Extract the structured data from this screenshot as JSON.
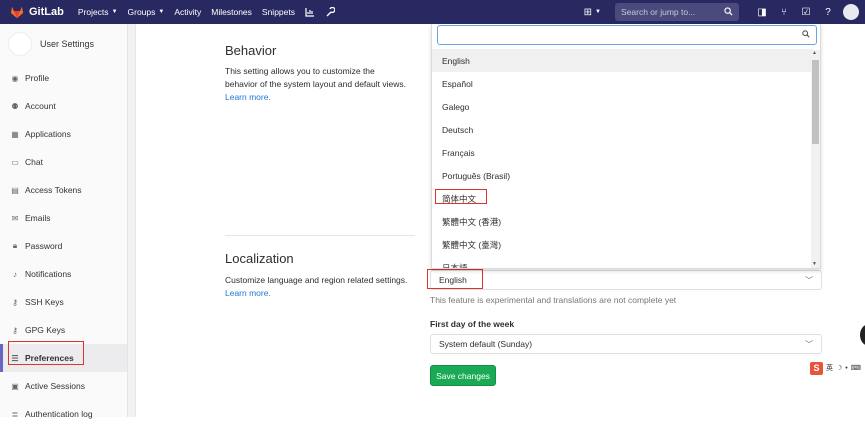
{
  "nav": {
    "brand": "GitLab",
    "items": [
      "Projects",
      "Groups",
      "Activity",
      "Milestones",
      "Snippets"
    ],
    "search_placeholder": "Search or jump to...",
    "colors": {
      "bar": "#292961",
      "accent": "#6666c4"
    }
  },
  "sidebar": {
    "title": "User Settings",
    "items": [
      {
        "label": "Profile",
        "icon": "user-circle-icon"
      },
      {
        "label": "Account",
        "icon": "account-icon"
      },
      {
        "label": "Applications",
        "icon": "grid-icon"
      },
      {
        "label": "Chat",
        "icon": "chat-icon"
      },
      {
        "label": "Access Tokens",
        "icon": "token-icon"
      },
      {
        "label": "Emails",
        "icon": "envelope-icon"
      },
      {
        "label": "Password",
        "icon": "lock-icon"
      },
      {
        "label": "Notifications",
        "icon": "bell-icon"
      },
      {
        "label": "SSH Keys",
        "icon": "key-icon"
      },
      {
        "label": "GPG Keys",
        "icon": "key-icon"
      },
      {
        "label": "Preferences",
        "icon": "sliders-icon",
        "active": true
      },
      {
        "label": "Active Sessions",
        "icon": "monitor-icon"
      },
      {
        "label": "Authentication log",
        "icon": "list-icon"
      }
    ]
  },
  "behavior": {
    "title": "Behavior",
    "desc1": "This setting allows you to customize the",
    "desc2": "behavior of the system layout and default views.",
    "link": "Learn more."
  },
  "localization": {
    "title": "Localization",
    "desc": "Customize language and region related settings.",
    "link": "Learn more.",
    "language_value": "English",
    "help": "This feature is experimental and translations are not complete yet",
    "first_day_label": "First day of the week",
    "first_day_value": "System default (Sunday)",
    "save_label": "Save changes"
  },
  "dropdown": {
    "options": [
      "English",
      "Español",
      "Galego",
      "Deutsch",
      "Français",
      "Português (Brasil)",
      "简体中文",
      "繁體中文 (香港)",
      "繁體中文 (臺灣)",
      "日本語"
    ],
    "highlighted": "English"
  },
  "ime": {
    "label": "英"
  }
}
